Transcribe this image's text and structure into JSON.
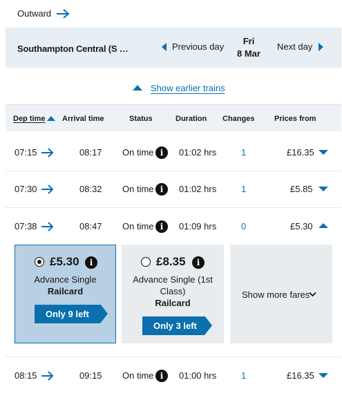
{
  "header": {
    "outward_label": "Outward",
    "station": "Southampton Central (S …",
    "prev_day": "Previous day",
    "day_name": "Fri",
    "day_date": "8 Mar",
    "next_day": "Next day",
    "earlier_trains": "Show earlier trains"
  },
  "columns": {
    "dep_time": "Dep time",
    "arrival": "Arrival time",
    "status": "Status",
    "duration": "Duration",
    "changes": "Changes",
    "prices": "Prices from"
  },
  "rows": [
    {
      "dep": "07:15",
      "arr": "08:17",
      "status": "On time",
      "duration": "01:02 hrs",
      "changes": "1",
      "price": "£16.35",
      "expanded": false
    },
    {
      "dep": "07:30",
      "arr": "08:32",
      "status": "On time",
      "duration": "01:02 hrs",
      "changes": "1",
      "price": "£5.85",
      "expanded": false
    },
    {
      "dep": "07:38",
      "arr": "08:47",
      "status": "On time",
      "duration": "01:09 hrs",
      "changes": "0",
      "price": "£5.30",
      "expanded": true
    },
    {
      "dep": "08:15",
      "arr": "09:15",
      "status": "On time",
      "duration": "01:00 hrs",
      "changes": "1",
      "price": "£16.35",
      "expanded": false
    }
  ],
  "fares": [
    {
      "price": "£5.30",
      "name": "Advance Single",
      "railcard": "Railcard",
      "left": "Only 9 left",
      "selected": true
    },
    {
      "price": "£8.35",
      "name_line1": "Advance Single (1st",
      "name_line2": "Class)",
      "railcard": "Railcard",
      "left": "Only 3 left",
      "selected": false
    }
  ],
  "more_fares": "Show more fares",
  "icons": {
    "arrow": "arrow-right-icon",
    "info": "info-icon",
    "chevron_left": "chevron-left-icon",
    "chevron_right": "chevron-right-icon",
    "chevron_down": "chevron-down-icon",
    "chevron_up": "chevron-up-icon"
  },
  "colors": {
    "accent": "#0b6fae",
    "header_bg": "#e7eef4",
    "selected_card": "#b8d0e4",
    "card_bg": "#e8ecef"
  }
}
